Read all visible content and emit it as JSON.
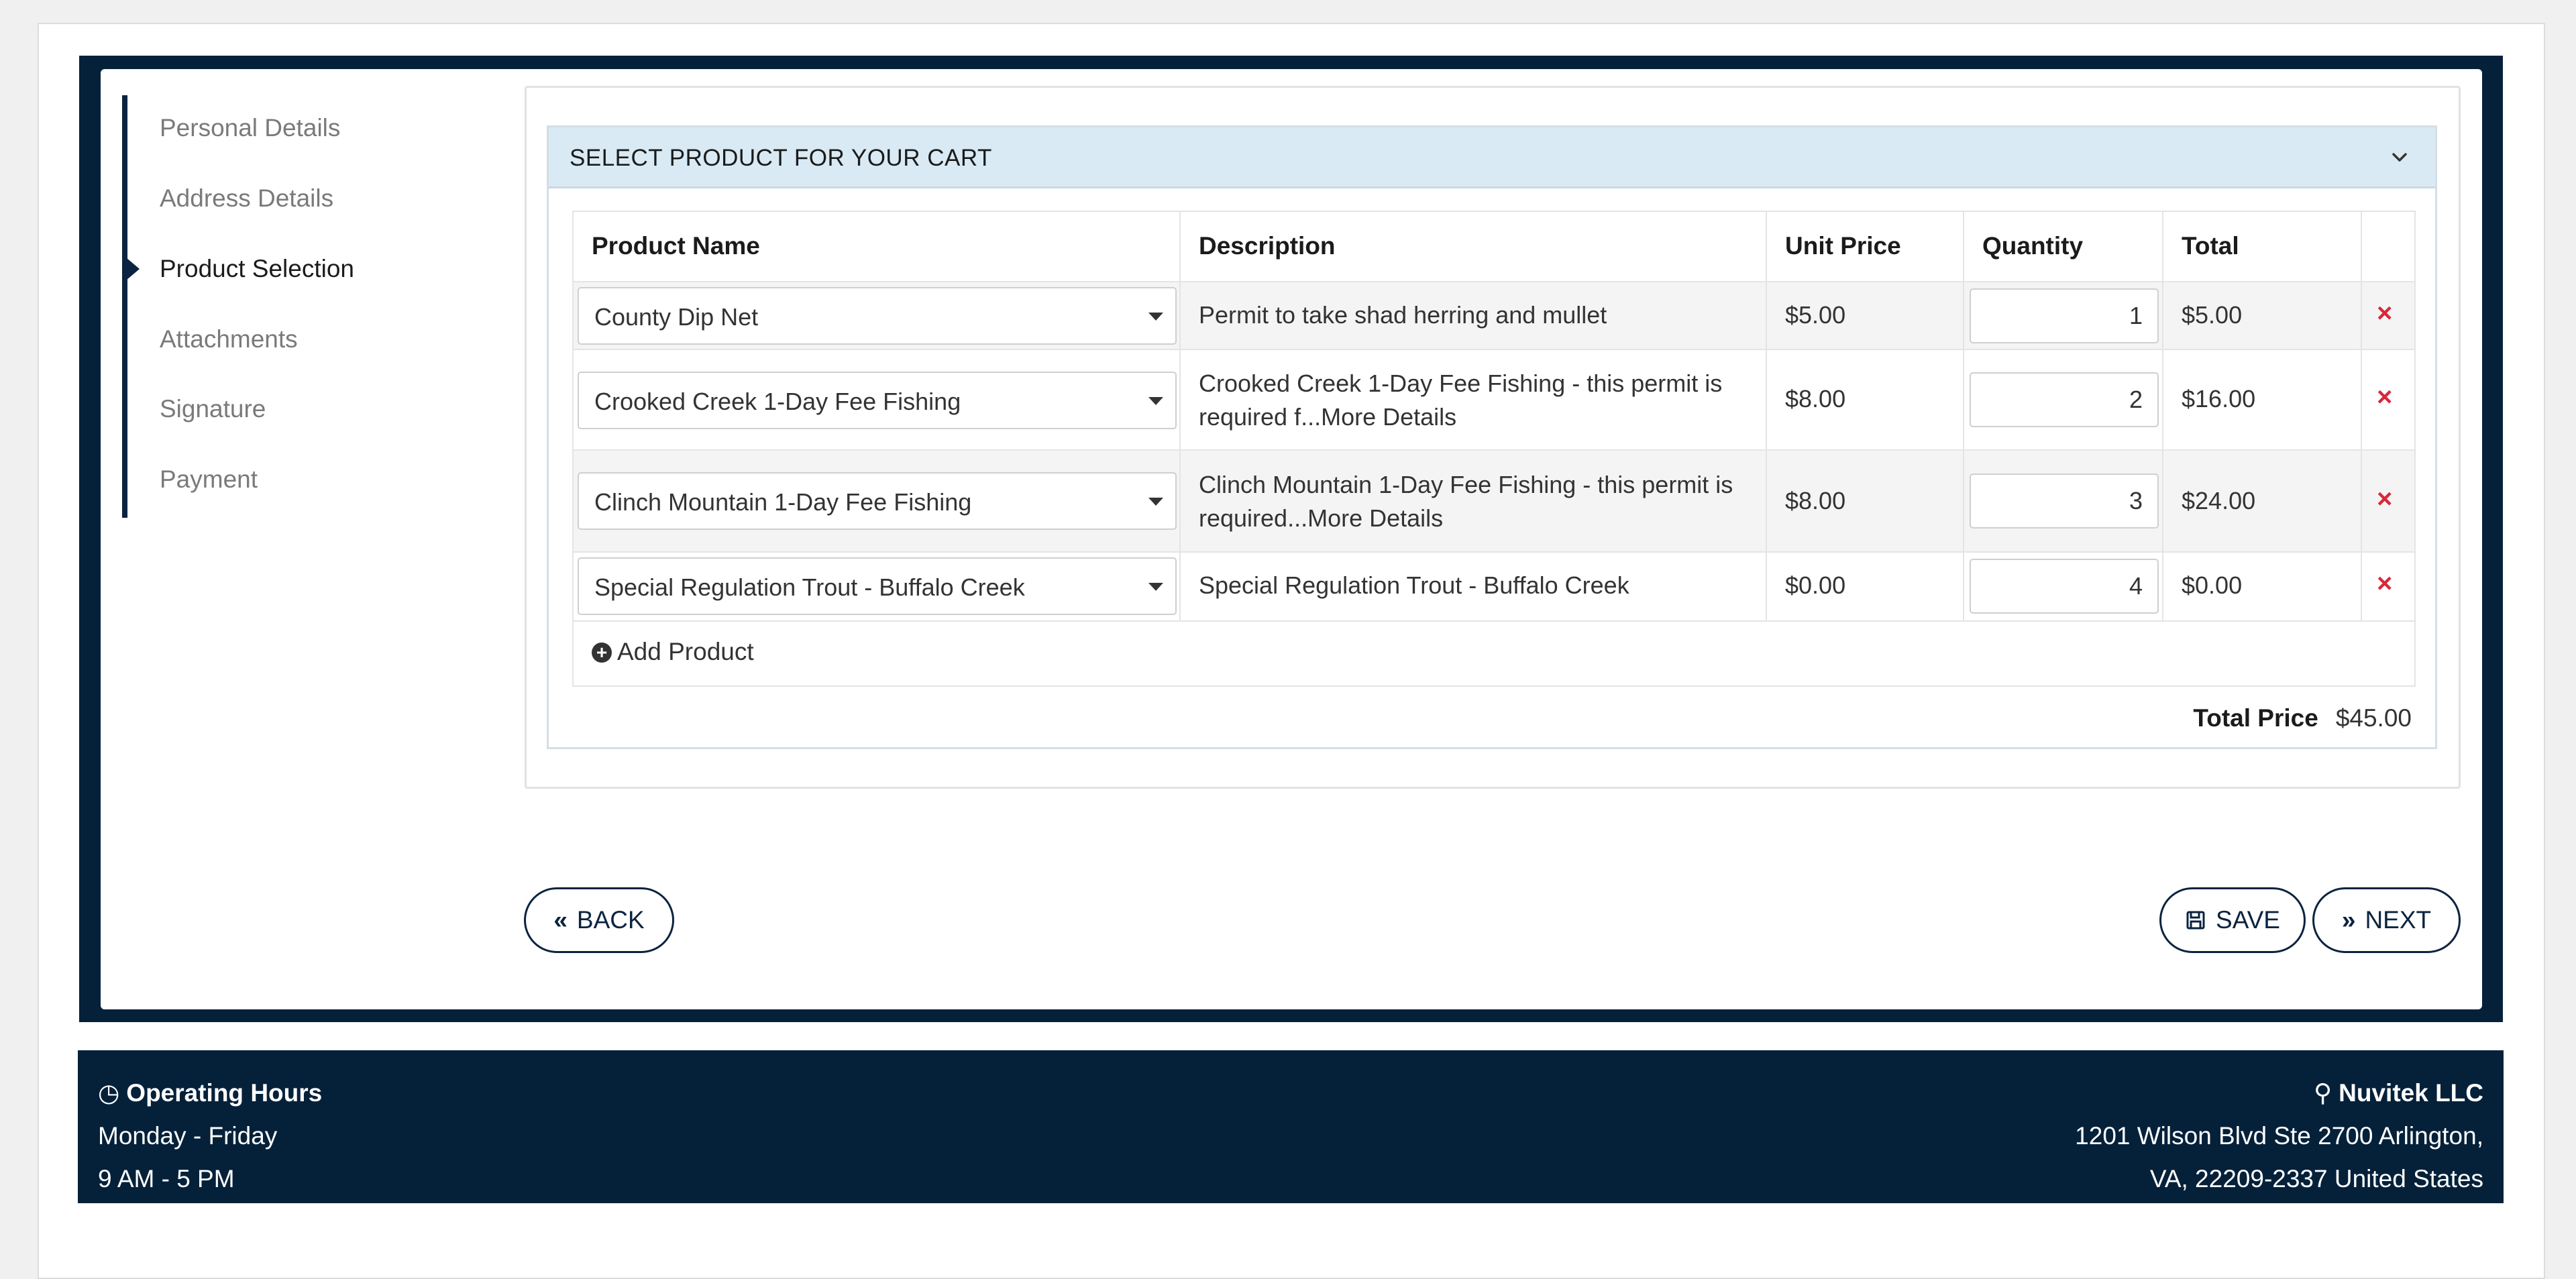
{
  "sidebar": {
    "items": [
      {
        "label": "Personal Details"
      },
      {
        "label": "Address Details"
      },
      {
        "label": "Product Selection"
      },
      {
        "label": "Attachments"
      },
      {
        "label": "Signature"
      },
      {
        "label": "Payment"
      }
    ],
    "active_index": 2
  },
  "panel": {
    "title": "SELECT PRODUCT FOR YOUR CART"
  },
  "table": {
    "headers": [
      "Product Name",
      "Description",
      "Unit Price",
      "Quantity",
      "Total"
    ],
    "rows": [
      {
        "product": "County Dip Net",
        "description": "Permit to take shad  herring  and mullet",
        "unit_price": "$5.00",
        "quantity": "1",
        "total": "$5.00"
      },
      {
        "product": "Crooked Creek 1-Day Fee Fishing",
        "description": "Crooked Creek 1-Day Fee Fishing - this permit is required f...More Details",
        "unit_price": "$8.00",
        "quantity": "2",
        "total": "$16.00"
      },
      {
        "product": "Clinch Mountain 1-Day Fee Fishing",
        "description": "Clinch Mountain 1-Day Fee Fishing - this permit is required...More Details",
        "unit_price": "$8.00",
        "quantity": "3",
        "total": "$24.00"
      },
      {
        "product": "Special Regulation Trout - Buffalo Creek",
        "description": "Special Regulation Trout - Buffalo Creek",
        "unit_price": "$0.00",
        "quantity": "4",
        "total": "$0.00"
      }
    ],
    "delete_glyph": "×",
    "add_product_label": "Add Product"
  },
  "totals": {
    "label": "Total Price",
    "value": "$45.00"
  },
  "buttons": {
    "back": "BACK",
    "save": "SAVE",
    "next": "NEXT"
  },
  "footer": {
    "hours_title": "Operating Hours",
    "hours_days": "Monday - Friday",
    "hours_time": "9 AM - 5 PM",
    "company": "Nuvitek LLC",
    "address_line1": "1201 Wilson Blvd Ste 2700 Arlington,",
    "address_line2": "VA, 22209-2337 United States"
  },
  "colors": {
    "navy": "#05213a",
    "panel_header": "#d9eaf4",
    "delete_red": "#d8283a"
  }
}
